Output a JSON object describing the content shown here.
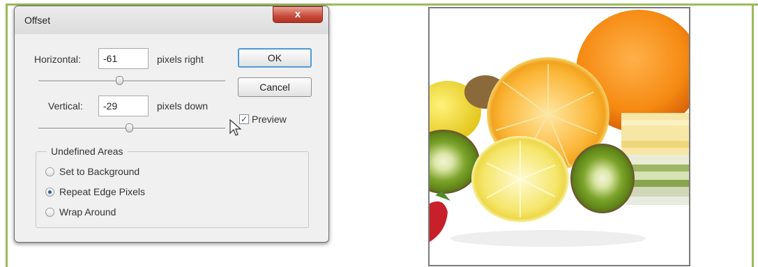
{
  "dialog": {
    "title": "Offset",
    "close_label": "x",
    "horizontal": {
      "label": "Horizontal:",
      "value": "-61",
      "unit": "pixels right"
    },
    "vertical": {
      "label": "Vertical:",
      "value": "-29",
      "unit": "pixels down"
    },
    "ok_label": "OK",
    "cancel_label": "Cancel",
    "preview": {
      "label": "Preview",
      "checked": true
    },
    "undefined_areas": {
      "title": "Undefined Areas",
      "options": [
        {
          "label": "Set to Background",
          "selected": false
        },
        {
          "label": "Repeat Edge Pixels",
          "selected": true
        },
        {
          "label": "Wrap Around",
          "selected": false
        }
      ]
    }
  },
  "image": {
    "subject": "fruit-photo-icon"
  },
  "colors": {
    "frame": "#9bbb59",
    "close_button": "#c7493a",
    "default_button_border": "#4e9bd6"
  }
}
